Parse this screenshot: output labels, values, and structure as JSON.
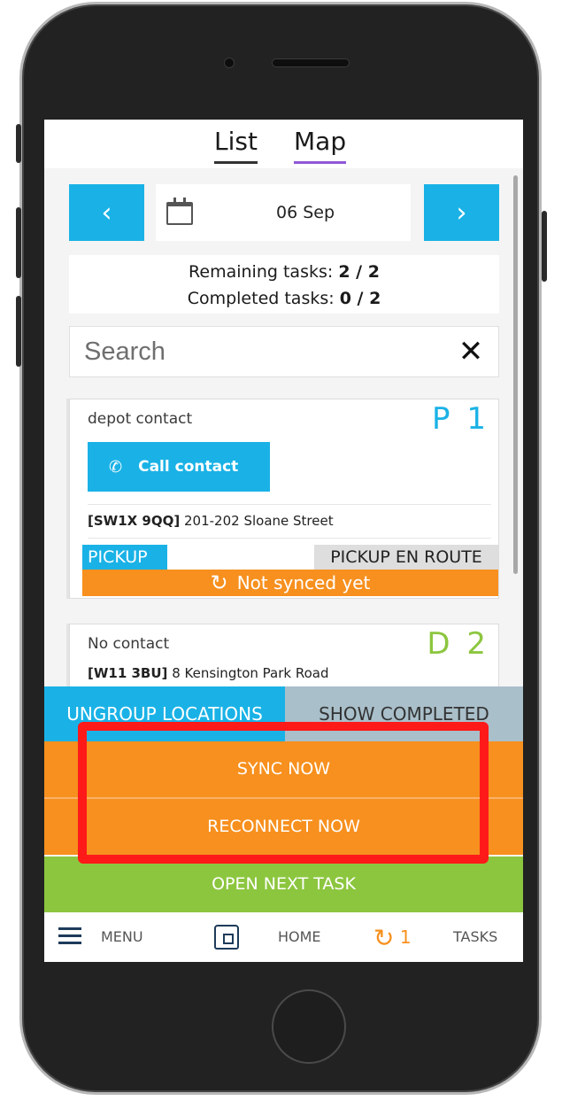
{
  "tabs": {
    "list": "List",
    "map": "Map"
  },
  "date_nav": {
    "prev_icon": "‹",
    "next_icon": "›",
    "date": "06 Sep"
  },
  "stats": {
    "remaining_label": "Remaining tasks:",
    "remaining_value": "2 / 2",
    "completed_label": "Completed tasks:",
    "completed_value": "0 / 2"
  },
  "search": {
    "placeholder": "Search",
    "clear_icon": "✕"
  },
  "tasks": [
    {
      "contact": "depot contact",
      "code": "P 1",
      "call_label": "Call contact",
      "postcode": "[SW1X 9QQ]",
      "address": "201-202 Sloane Street",
      "type": "PICKUP",
      "status": "PICKUP EN ROUTE",
      "sync_status": "Not synced yet"
    },
    {
      "contact": "No contact",
      "code": "D 2",
      "postcode": "[W11 3BU]",
      "address": "8 Kensington Park Road"
    }
  ],
  "actions": {
    "ungroup": "UNGROUP LOCATIONS",
    "show_completed": "SHOW COMPLETED",
    "sync_now": "SYNC NOW",
    "reconnect_now": "RECONNECT NOW",
    "open_next": "OPEN NEXT TASK"
  },
  "bottom_nav": {
    "menu": "MENU",
    "home": "HOME",
    "sync_count": "1",
    "tasks": "TASKS"
  },
  "colors": {
    "accent_blue": "#1ab2e6",
    "sync_orange": "#f7901e",
    "success_green": "#8cc63f",
    "highlight_red": "#ff1a1a"
  },
  "icons": [
    "calendar-icon",
    "phone-icon",
    "sync-icon",
    "close-icon",
    "menu-icon",
    "home-icon",
    "chevron-left-icon",
    "chevron-right-icon"
  ]
}
